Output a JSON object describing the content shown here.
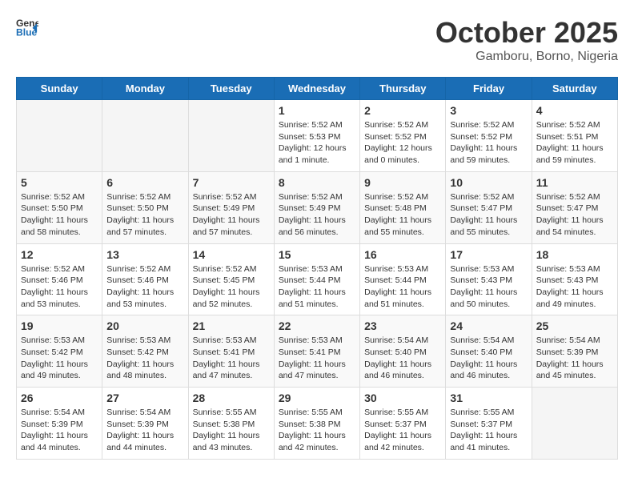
{
  "logo": {
    "general": "General",
    "blue": "Blue"
  },
  "header": {
    "month": "October 2025",
    "location": "Gamboru, Borno, Nigeria"
  },
  "weekdays": [
    "Sunday",
    "Monday",
    "Tuesday",
    "Wednesday",
    "Thursday",
    "Friday",
    "Saturday"
  ],
  "weeks": [
    [
      {
        "day": "",
        "info": ""
      },
      {
        "day": "",
        "info": ""
      },
      {
        "day": "",
        "info": ""
      },
      {
        "day": "1",
        "info": "Sunrise: 5:52 AM\nSunset: 5:53 PM\nDaylight: 12 hours\nand 1 minute."
      },
      {
        "day": "2",
        "info": "Sunrise: 5:52 AM\nSunset: 5:52 PM\nDaylight: 12 hours\nand 0 minutes."
      },
      {
        "day": "3",
        "info": "Sunrise: 5:52 AM\nSunset: 5:52 PM\nDaylight: 11 hours\nand 59 minutes."
      },
      {
        "day": "4",
        "info": "Sunrise: 5:52 AM\nSunset: 5:51 PM\nDaylight: 11 hours\nand 59 minutes."
      }
    ],
    [
      {
        "day": "5",
        "info": "Sunrise: 5:52 AM\nSunset: 5:50 PM\nDaylight: 11 hours\nand 58 minutes."
      },
      {
        "day": "6",
        "info": "Sunrise: 5:52 AM\nSunset: 5:50 PM\nDaylight: 11 hours\nand 57 minutes."
      },
      {
        "day": "7",
        "info": "Sunrise: 5:52 AM\nSunset: 5:49 PM\nDaylight: 11 hours\nand 57 minutes."
      },
      {
        "day": "8",
        "info": "Sunrise: 5:52 AM\nSunset: 5:49 PM\nDaylight: 11 hours\nand 56 minutes."
      },
      {
        "day": "9",
        "info": "Sunrise: 5:52 AM\nSunset: 5:48 PM\nDaylight: 11 hours\nand 55 minutes."
      },
      {
        "day": "10",
        "info": "Sunrise: 5:52 AM\nSunset: 5:47 PM\nDaylight: 11 hours\nand 55 minutes."
      },
      {
        "day": "11",
        "info": "Sunrise: 5:52 AM\nSunset: 5:47 PM\nDaylight: 11 hours\nand 54 minutes."
      }
    ],
    [
      {
        "day": "12",
        "info": "Sunrise: 5:52 AM\nSunset: 5:46 PM\nDaylight: 11 hours\nand 53 minutes."
      },
      {
        "day": "13",
        "info": "Sunrise: 5:52 AM\nSunset: 5:46 PM\nDaylight: 11 hours\nand 53 minutes."
      },
      {
        "day": "14",
        "info": "Sunrise: 5:52 AM\nSunset: 5:45 PM\nDaylight: 11 hours\nand 52 minutes."
      },
      {
        "day": "15",
        "info": "Sunrise: 5:53 AM\nSunset: 5:44 PM\nDaylight: 11 hours\nand 51 minutes."
      },
      {
        "day": "16",
        "info": "Sunrise: 5:53 AM\nSunset: 5:44 PM\nDaylight: 11 hours\nand 51 minutes."
      },
      {
        "day": "17",
        "info": "Sunrise: 5:53 AM\nSunset: 5:43 PM\nDaylight: 11 hours\nand 50 minutes."
      },
      {
        "day": "18",
        "info": "Sunrise: 5:53 AM\nSunset: 5:43 PM\nDaylight: 11 hours\nand 49 minutes."
      }
    ],
    [
      {
        "day": "19",
        "info": "Sunrise: 5:53 AM\nSunset: 5:42 PM\nDaylight: 11 hours\nand 49 minutes."
      },
      {
        "day": "20",
        "info": "Sunrise: 5:53 AM\nSunset: 5:42 PM\nDaylight: 11 hours\nand 48 minutes."
      },
      {
        "day": "21",
        "info": "Sunrise: 5:53 AM\nSunset: 5:41 PM\nDaylight: 11 hours\nand 47 minutes."
      },
      {
        "day": "22",
        "info": "Sunrise: 5:53 AM\nSunset: 5:41 PM\nDaylight: 11 hours\nand 47 minutes."
      },
      {
        "day": "23",
        "info": "Sunrise: 5:54 AM\nSunset: 5:40 PM\nDaylight: 11 hours\nand 46 minutes."
      },
      {
        "day": "24",
        "info": "Sunrise: 5:54 AM\nSunset: 5:40 PM\nDaylight: 11 hours\nand 46 minutes."
      },
      {
        "day": "25",
        "info": "Sunrise: 5:54 AM\nSunset: 5:39 PM\nDaylight: 11 hours\nand 45 minutes."
      }
    ],
    [
      {
        "day": "26",
        "info": "Sunrise: 5:54 AM\nSunset: 5:39 PM\nDaylight: 11 hours\nand 44 minutes."
      },
      {
        "day": "27",
        "info": "Sunrise: 5:54 AM\nSunset: 5:39 PM\nDaylight: 11 hours\nand 44 minutes."
      },
      {
        "day": "28",
        "info": "Sunrise: 5:55 AM\nSunset: 5:38 PM\nDaylight: 11 hours\nand 43 minutes."
      },
      {
        "day": "29",
        "info": "Sunrise: 5:55 AM\nSunset: 5:38 PM\nDaylight: 11 hours\nand 42 minutes."
      },
      {
        "day": "30",
        "info": "Sunrise: 5:55 AM\nSunset: 5:37 PM\nDaylight: 11 hours\nand 42 minutes."
      },
      {
        "day": "31",
        "info": "Sunrise: 5:55 AM\nSunset: 5:37 PM\nDaylight: 11 hours\nand 41 minutes."
      },
      {
        "day": "",
        "info": ""
      }
    ]
  ]
}
